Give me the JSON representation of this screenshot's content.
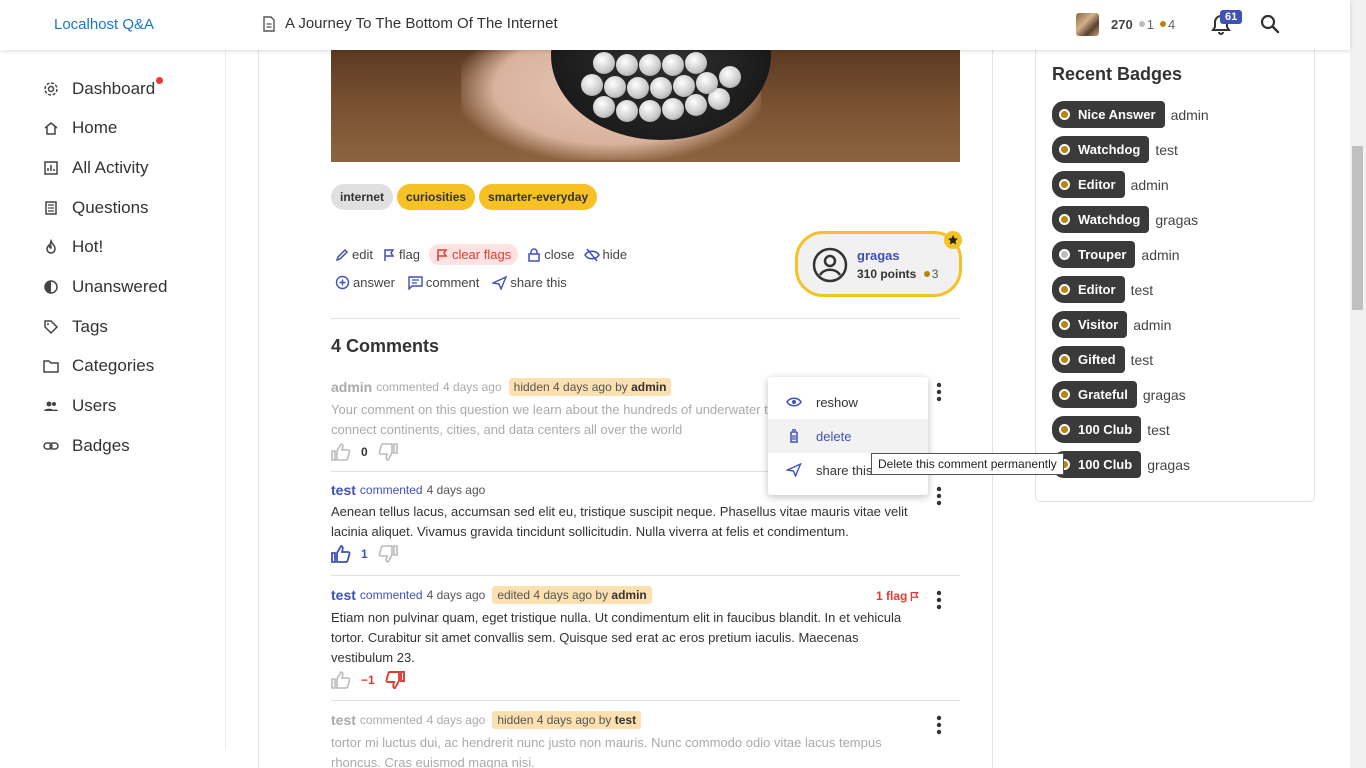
{
  "header": {
    "brand": "Localhost Q&A",
    "page_title": "A Journey To The Bottom Of The Internet",
    "reputation": "270",
    "silver_count": "1",
    "bronze_count": "4",
    "notifications": "61"
  },
  "sidebar": {
    "items": [
      {
        "label": "Dashboard",
        "icon": "gear-icon"
      },
      {
        "label": "Home",
        "icon": "home-icon"
      },
      {
        "label": "All Activity",
        "icon": "activity-icon"
      },
      {
        "label": "Questions",
        "icon": "questions-icon"
      },
      {
        "label": "Hot!",
        "icon": "flame-icon"
      },
      {
        "label": "Unanswered",
        "icon": "unanswered-icon"
      },
      {
        "label": "Tags",
        "icon": "tag-icon"
      },
      {
        "label": "Categories",
        "icon": "folder-icon"
      },
      {
        "label": "Users",
        "icon": "users-icon"
      },
      {
        "label": "Badges",
        "icon": "link-icon"
      }
    ]
  },
  "question": {
    "tags": [
      "internet",
      "curiosities",
      "smarter-everyday"
    ],
    "actions": {
      "edit": "edit",
      "flag": "flag",
      "clear_flags": "clear flags",
      "close": "close",
      "hide": "hide",
      "answer": "answer",
      "comment": "comment",
      "share": "share this"
    },
    "author": {
      "name": "gragas",
      "points": "310 points",
      "badges": "3"
    }
  },
  "comments": {
    "title": "4 Comments",
    "items": [
      {
        "author": "admin",
        "verb": "commented",
        "time": "4 days ago",
        "note_prefix": "hidden 4 days ago by",
        "note_user": "admin",
        "body": "Your comment on this question we learn about the hundreds of underwater t... connect continents, cities, and data centers all over the world",
        "body_line1": "Your comment on this question we learn about the hundreds of underwater t",
        "body_line2": "connect continents, cities, and data centers all over the world",
        "votes": "0"
      },
      {
        "author": "test",
        "verb": "commented",
        "time": "4 days ago",
        "body_line1": "Aenean tellus lacus, accumsan sed elit eu, tristique suscipit neque. Phasellus vitae mauris vitae velit",
        "body_line2": "lacinia aliquet. Vivamus gravida tincidunt sollicitudin. Nulla viverra at felis et condimentum.",
        "votes": "1"
      },
      {
        "author": "test",
        "verb": "commented",
        "time": "4 days ago",
        "note_prefix": "edited 4 days ago by",
        "note_user": "admin",
        "flags": "1 flag",
        "body_line1": "Etiam non pulvinar quam, eget tristique nulla. Ut condimentum elit in faucibus blandit. In et vehicula",
        "body_line2": "tortor. Curabitur sit amet convallis sem. Quisque sed erat ac eros pretium iaculis. Maecenas",
        "body_line3": "vestibulum 23.",
        "votes": "−1"
      },
      {
        "author": "test",
        "verb": "commented",
        "time": "4 days ago",
        "note_prefix": "hidden 4 days ago by",
        "note_user": "test",
        "body_line1": "tortor mi luctus dui, ac hendrerit nunc justo non mauris. Nunc commodo odio vitae lacus tempus",
        "body_line2": "rhoncus. Cras euismod magna nisi."
      }
    ]
  },
  "context_menu": {
    "reshow": "reshow",
    "delete": "delete",
    "share": "share this",
    "tooltip": "Delete this comment permanently"
  },
  "recent_badges": {
    "title": "Recent Badges",
    "items": [
      {
        "badge": "Nice Answer",
        "user": "admin",
        "tier": "bronze"
      },
      {
        "badge": "Watchdog",
        "user": "test",
        "tier": "bronze"
      },
      {
        "badge": "Editor",
        "user": "admin",
        "tier": "bronze"
      },
      {
        "badge": "Watchdog",
        "user": "gragas",
        "tier": "bronze"
      },
      {
        "badge": "Trouper",
        "user": "admin",
        "tier": "silver"
      },
      {
        "badge": "Editor",
        "user": "test",
        "tier": "bronze"
      },
      {
        "badge": "Visitor",
        "user": "admin",
        "tier": "bronze"
      },
      {
        "badge": "Gifted",
        "user": "test",
        "tier": "bronze"
      },
      {
        "badge": "Grateful",
        "user": "gragas",
        "tier": "bronze"
      },
      {
        "badge": "100 Club",
        "user": "test",
        "tier": "bronze"
      },
      {
        "badge": "100 Club",
        "user": "gragas",
        "tier": "bronze"
      }
    ]
  },
  "colors": {
    "accent": "#3f51b5",
    "brand": "#1976d2",
    "tag_yellow": "#f5c125",
    "flag_red": "#e53935",
    "bronze": "#b8860b",
    "silver": "#bdbdbd"
  }
}
